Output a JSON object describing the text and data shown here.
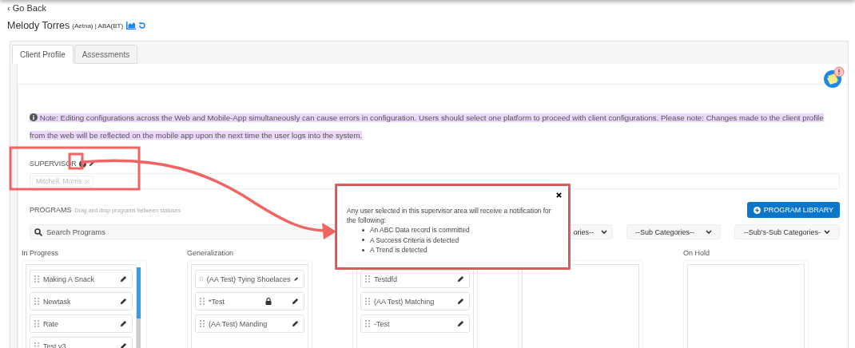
{
  "back_link": "‹ Go Back",
  "client": {
    "name": "Melody Torres",
    "meta": "(Aetna) | ABA(BT)"
  },
  "tabs": [
    {
      "label": "Client Profile",
      "selected": true
    },
    {
      "label": "Assessments",
      "selected": false
    }
  ],
  "note": "Note: Editing configurations across the Web and Mobile-App simultaneously can cause errors in configuration. Users should select one platform to proceed with client configurations. Please note: Changes made to the client profile from the web will be reflected on the mobile app upon the next time the user logs into the system.",
  "supervisor": {
    "label": "SUPERVISOR",
    "chips": [
      "Mitchell, Morris"
    ]
  },
  "programs": {
    "label": "PROGRAMS",
    "hint": "Drag and drop programs between statuses",
    "library_button": "PROGRAM LIBRARY",
    "search": {
      "placeholder": "Search Programs"
    },
    "filters": [
      "ories--",
      "--Sub Categories--",
      "--Sub's-Sub Categories-"
    ]
  },
  "columns": [
    {
      "title": "In Progress",
      "scrollable": true,
      "items": [
        {
          "label": "Making A Snack",
          "locked": false
        },
        {
          "label": "Newtask",
          "locked": false
        },
        {
          "label": "Rate",
          "locked": false
        },
        {
          "label": "Test v3",
          "locked": false
        }
      ]
    },
    {
      "title": "Generalization",
      "scrollable": false,
      "items": [
        {
          "label": "(AA Test) Tying Shoelaces",
          "locked": false
        },
        {
          "label": "*Test",
          "locked": true
        },
        {
          "label": "(AA Test) Manding",
          "locked": false
        }
      ]
    },
    {
      "scrollable": false,
      "items": [
        {
          "label": "Testdfd",
          "locked": false
        },
        {
          "label": "(AA Test) Matching",
          "locked": false
        },
        {
          "label": "-Test",
          "locked": false
        }
      ]
    },
    {
      "scrollable": false
    },
    {
      "title": "On Hold",
      "scrollable": false
    }
  ],
  "popover": {
    "text": "Any user selected in this supervisor area will receive a notification for the following:",
    "bullets": [
      "An ABC Data record is committed",
      "A Success Criteria is detected",
      "A Trend is detected"
    ]
  }
}
